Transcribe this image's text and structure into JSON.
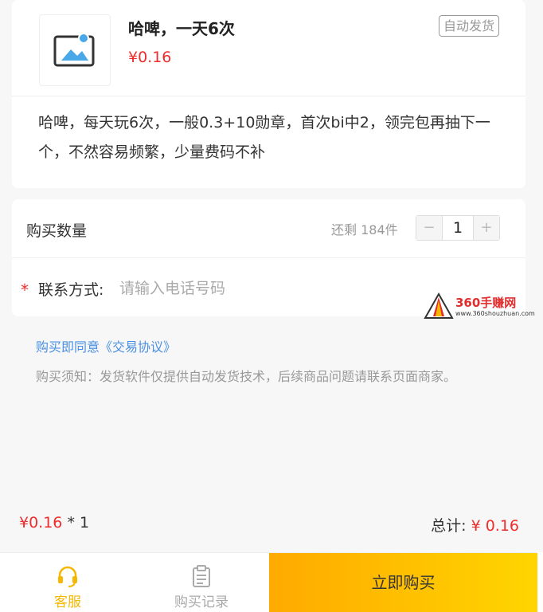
{
  "product": {
    "title": "哈啤，一天6次",
    "price": "¥0.16",
    "badge": "自动发货",
    "description": "哈啤，每天玩6次，一般0.3+10勋章，首次bi中2，领完包再抽下一个，不然容易频繁，少量费码不补",
    "thumbnail_icon": "image-placeholder-icon"
  },
  "purchase": {
    "quantity_label": "购买数量",
    "stock_text": "还剩 184件",
    "minus": "−",
    "plus": "+",
    "quantity": "1",
    "required_mark": "*",
    "contact_label": "联系方式:",
    "contact_placeholder": "请输入电话号码",
    "contact_value": ""
  },
  "watermark": {
    "text": "360手赚网",
    "url_text": "www.360shouzhuan.com"
  },
  "agreement_text": "购买即同意《交易协议》",
  "notice_text": "购买须知：发货软件仅提供自动发货技术，后续商品问题请联系页面商家。",
  "summary": {
    "unit_price": "¥0.16",
    "times_qty": " * 1",
    "total_label": "总计: ",
    "total_price": "¥ 0.16"
  },
  "bottom_bar": {
    "service_label": "客服",
    "records_label": "购买记录",
    "buy_label": "立即购买"
  },
  "colors": {
    "price_red": "#ee2d2d",
    "accent_yellow": "#f5b800",
    "link_blue": "#4a90e2"
  }
}
